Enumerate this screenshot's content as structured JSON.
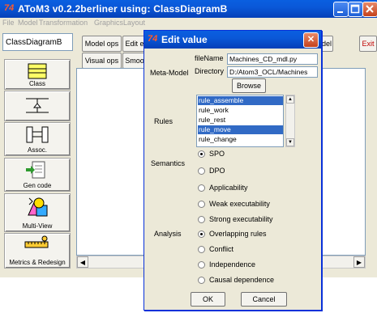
{
  "main": {
    "title": "AToM3 v0.2.2berliner using: ClassDiagramB",
    "logo": "74",
    "menu": [
      "File",
      "Model",
      "Transformation",
      "Graphics",
      "Layout"
    ],
    "left_label": "ClassDiagramB",
    "toolbar": {
      "model_ops": "Model ops",
      "edit": "Edit e",
      "visual_ops": "Visual ops",
      "smooth": "Smoo",
      "del": "del",
      "exit": "Exit"
    },
    "tools": [
      "Class",
      "",
      "Assoc.",
      "Gen code",
      "Multi-View",
      "Metrics & Redesign"
    ]
  },
  "dialog": {
    "title": "Edit value",
    "logo": "74",
    "close": "✕",
    "meta_model_label": "Meta-Model",
    "filename_label": "fileName",
    "filename_value": "Machines_CD_mdl.py",
    "directory_label": "Directory",
    "directory_value": "D:/Atom3_OCL/Machines",
    "browse": "Browse",
    "rules_label": "Rules",
    "rules": [
      "rule_assemble",
      "rule_work",
      "rule_rest",
      "rule_move",
      "rule_change"
    ],
    "selected_rules": [
      "rule_assemble",
      "rule_move"
    ],
    "semantics_label": "Semantics",
    "semantics_options": [
      "SPO",
      "DPO"
    ],
    "semantics_selected": "SPO",
    "analysis_label": "Analysis",
    "analysis_options": [
      "Applicability",
      "Weak executability",
      "Strong executability",
      "Overlapping rules",
      "Conflict",
      "Independence",
      "Causal dependence"
    ],
    "analysis_selected": "Overlapping rules",
    "ok": "OK",
    "cancel": "Cancel"
  },
  "colors": {
    "titlebar": "#0a58d8",
    "selection": "#316ac5",
    "exit_text": "#c00000"
  }
}
